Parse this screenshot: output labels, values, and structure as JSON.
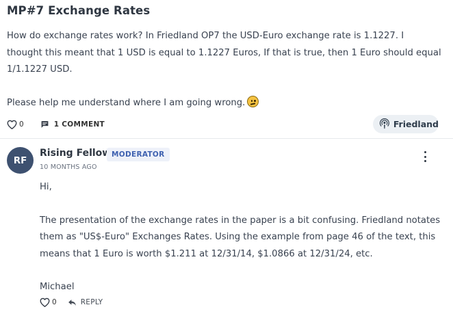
{
  "post": {
    "title": "MP#7 Exchange Rates",
    "body_line1": "How do exchange rates work? In Friedland OP7 the USD-Euro exchange rate is 1.1227. I",
    "body_line2": "thought this meant that 1 USD is equal to 1.1227 Euros, If that is true, then 1 Euro should equal",
    "body_line3": "1/1.1227 USD.",
    "body_line4": "Please help me understand where I am going wrong.",
    "emoji_icon": "confused-face-icon",
    "like_count": "0",
    "comment_count_label": "1 COMMENT",
    "topic": "Friedland"
  },
  "comment": {
    "avatar_initials": "RF",
    "author": "Rising Fellow",
    "role": "MODERATOR",
    "time": "10 MONTHS AGO",
    "greeting": "Hi,",
    "para1_line1": "The presentation of the exchange rates in the paper is a bit confusing. Friedland notates",
    "para1_line2": "them as \"US$-Euro\" Exchanges Rates. Using the example from page 46 of the text, this",
    "para1_line3": "means that 1 Euro is worth $1.211 at 12/31/14,  $1.0866 at 12/31/24, etc.",
    "signature": "Michael",
    "like_count": "0",
    "reply_label": "REPLY"
  },
  "colors": {
    "avatar_bg": "#3e5170",
    "badge_bg": "#eef1f9",
    "badge_text": "#3f61b0",
    "chip_bg": "#ecf0f4",
    "emoji_fill": "#f6c342"
  }
}
